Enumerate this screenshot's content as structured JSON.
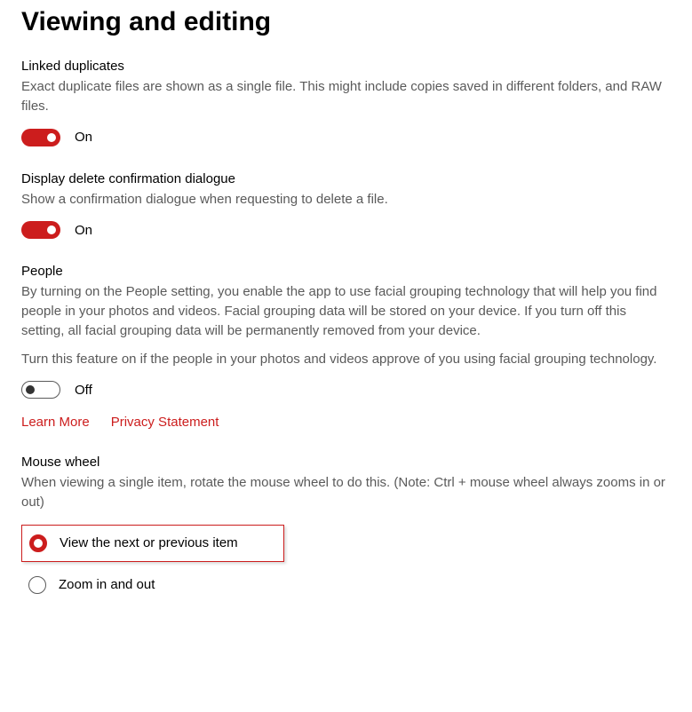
{
  "page_title": "Viewing and editing",
  "linked_duplicates": {
    "title": "Linked duplicates",
    "description": "Exact duplicate files are shown as a single file. This might include copies saved in different folders, and RAW files.",
    "toggle_state": "on",
    "toggle_label": "On"
  },
  "delete_confirmation": {
    "title": "Display delete confirmation dialogue",
    "description": "Show a confirmation dialogue when requesting to delete a file.",
    "toggle_state": "on",
    "toggle_label": "On"
  },
  "people": {
    "title": "People",
    "description1": "By turning on the People setting, you enable the app to use facial grouping technology that will help you find people in your photos and videos. Facial grouping data will be stored on your device. If you turn off this setting, all facial grouping data will be permanently removed from your device.",
    "description2": "Turn this feature on if the people in your photos and videos approve of you using facial grouping technology.",
    "toggle_state": "off",
    "toggle_label": "Off",
    "learn_more": "Learn More",
    "privacy_statement": "Privacy Statement"
  },
  "mouse_wheel": {
    "title": "Mouse wheel",
    "description": "When viewing a single item, rotate the mouse wheel to do this. (Note: Ctrl + mouse wheel always zooms in or out)",
    "options": [
      {
        "label": "View the next or previous item",
        "selected": true
      },
      {
        "label": "Zoom in and out",
        "selected": false
      }
    ]
  },
  "colors": {
    "accent": "#cc1d1d"
  }
}
